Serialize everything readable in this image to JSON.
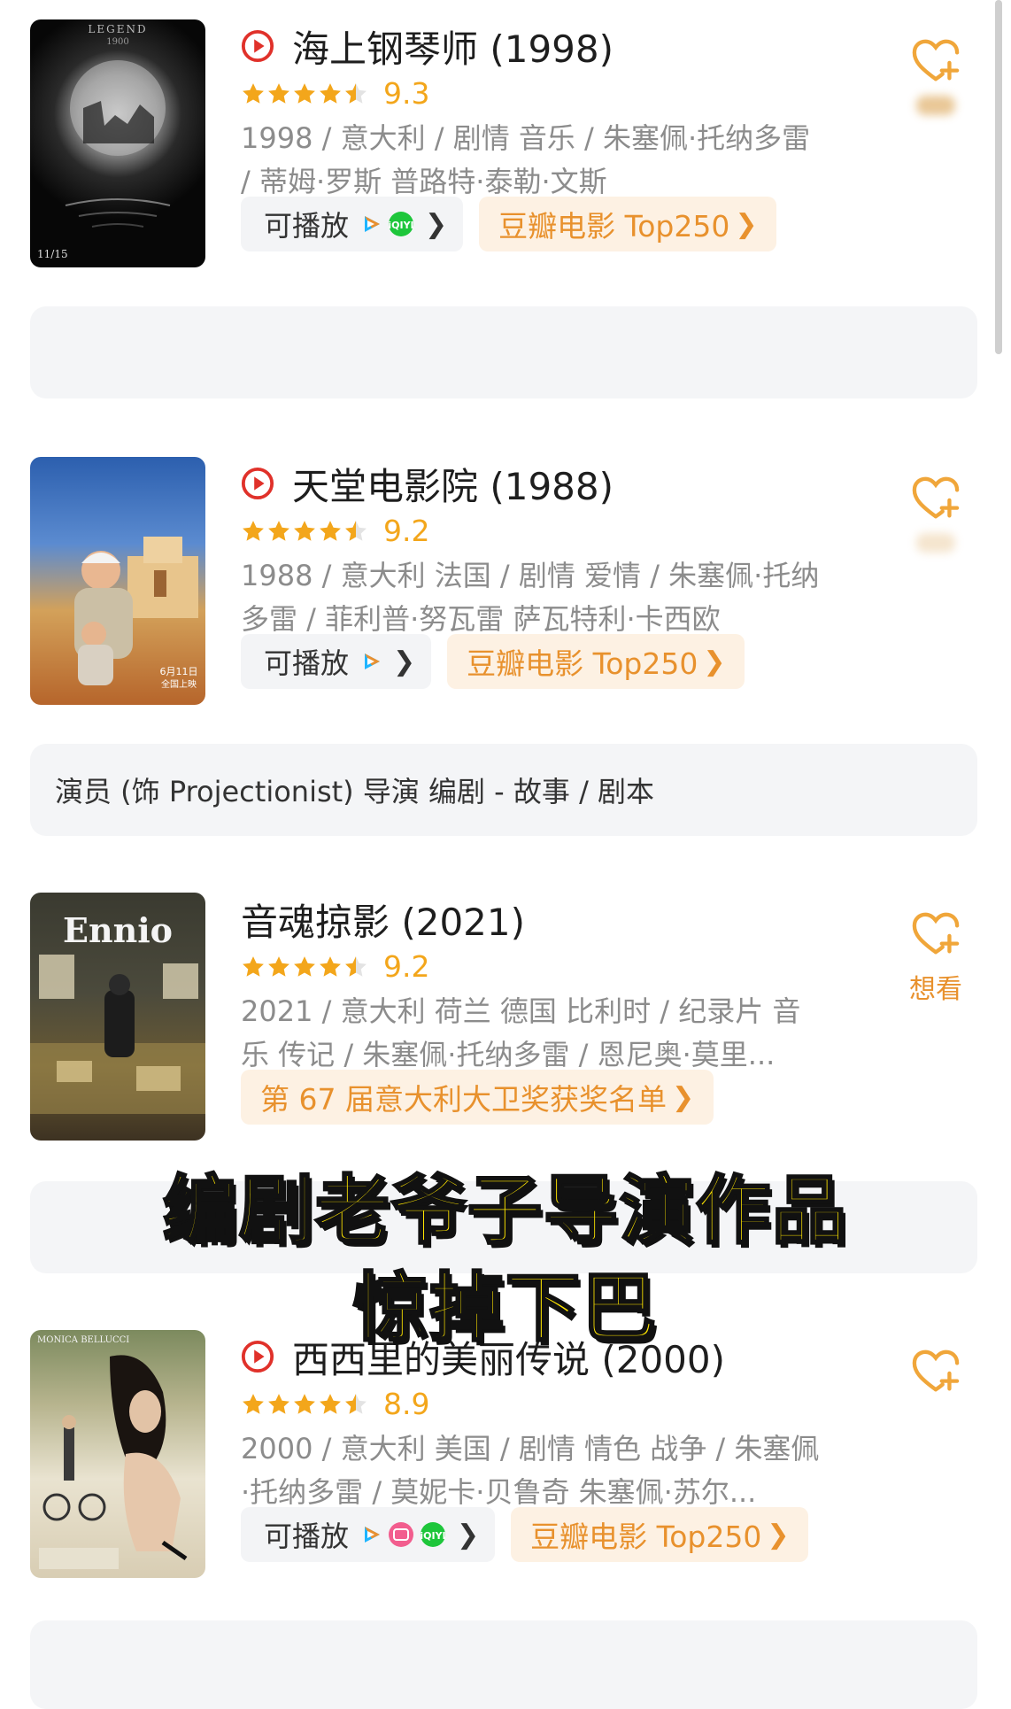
{
  "movies": [
    {
      "title": "海上钢琴师 (1998)",
      "rating": "9.3",
      "meta": "1998 / 意大利 / 剧情 音乐 / 朱塞佩·托纳多雷 / 蒂姆·罗斯 普路特·泰勒·文斯",
      "play_label": "可播放",
      "rank_label": "豆瓣电影 Top250",
      "wish_label": "",
      "poster_text": [
        "LEGEND",
        "1900",
        "11/15"
      ]
    },
    {
      "title": "天堂电影院 (1988)",
      "rating": "9.2",
      "meta": "1988 / 意大利 法国 / 剧情 爱情 / 朱塞佩·托纳多雷 / 菲利普·努瓦雷 萨瓦特利·卡西欧",
      "play_label": "可播放",
      "rank_label": "豆瓣电影 Top250",
      "wish_label": "",
      "poster_text": [
        "6月11日",
        "全国上映"
      ]
    },
    {
      "title": "音魂掠影 (2021)",
      "rating": "9.2",
      "meta": "2021 / 意大利 荷兰 德国 比利时 / 纪录片 音乐 传记 / 朱塞佩·托纳多雷 / 恩尼奥·莫里...",
      "award_label": "第 67 届意大利大卫奖获奖名单",
      "wish_label": "想看",
      "poster_text": [
        "Ennio"
      ]
    },
    {
      "title": "西西里的美丽传说 (2000)",
      "rating": "8.9",
      "meta": "2000 / 意大利 美国 / 剧情 情色 战争 / 朱塞佩·托纳多雷 / 莫妮卡·贝鲁奇 朱塞佩·苏尔...",
      "play_label": "可播放",
      "rank_label": "豆瓣电影 Top250",
      "wish_label": "",
      "poster_text": [
        "MONICA BELLUCCI"
      ]
    }
  ],
  "panels": {
    "cinema_paradiso_role": "演员 (饰 Projectionist) 导演 编剧 - 故事 / 剧本"
  },
  "overlay": {
    "line1": "编剧老爷子导演作品",
    "line2": "惊掉下巴"
  },
  "platform_icons": [
    "tencent-video-icon",
    "iqiyi-icon",
    "bilibili-icon"
  ],
  "colors": {
    "accent": "#e8912d",
    "star": "#f3a61b",
    "play_red": "#e0312a",
    "overlay_yellow": "#ffe600"
  }
}
